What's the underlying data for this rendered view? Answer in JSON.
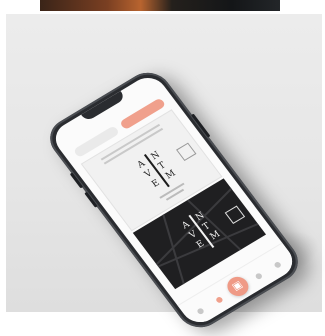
{
  "screen": {
    "app_title": "",
    "tabs": [
      "",
      ""
    ],
    "nav_center_icon": "qr-icon"
  },
  "colors": {
    "accent": "#ef9a86",
    "phone_body": "#2a2c30",
    "background": "#e8e8e8"
  }
}
